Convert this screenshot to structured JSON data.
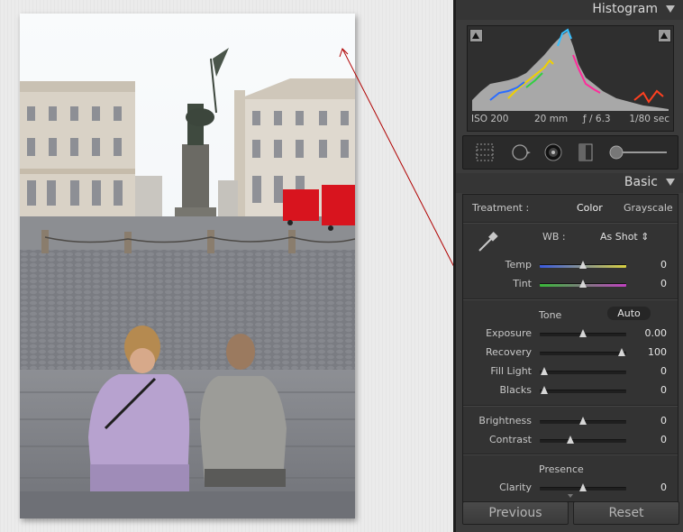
{
  "panel": {
    "histogram": {
      "title": "Histogram",
      "iso": "ISO 200",
      "focal": "20 mm",
      "aperture": "ƒ / 6.3",
      "shutter": "1/80 sec"
    },
    "basic": {
      "title": "Basic",
      "treatment_label": "Treatment :",
      "treatment_options": [
        "Color",
        "Grayscale"
      ],
      "treatment_selected": "Color",
      "wb_label": "WB :",
      "wb_value": "As Shot ⇕",
      "sliders_wb": [
        {
          "label": "Temp",
          "value": "0",
          "level": 0.5
        },
        {
          "label": "Tint",
          "value": "0",
          "level": 0.5
        }
      ],
      "tone_label": "Tone",
      "auto_label": "Auto",
      "sliders_tone": [
        {
          "label": "Exposure",
          "value": "0.00",
          "level": 0.5
        },
        {
          "label": "Recovery",
          "value": "100",
          "level": 0.95
        },
        {
          "label": "Fill Light",
          "value": "0",
          "level": 0.05
        },
        {
          "label": "Blacks",
          "value": "0",
          "level": 0.05
        }
      ],
      "sliders_bc": [
        {
          "label": "Brightness",
          "value": "0",
          "level": 0.5
        },
        {
          "label": "Contrast",
          "value": "0",
          "level": 0.35
        }
      ],
      "presence_label": "Presence",
      "sliders_presence": [
        {
          "label": "Clarity",
          "value": "0",
          "level": 0.5
        }
      ]
    },
    "buttons": {
      "previous": "Previous",
      "reset": "Reset"
    }
  },
  "colors": {
    "panel_bg": "#3b3b3b",
    "annotation": "#b00000",
    "truck_red": "#d8141e"
  }
}
